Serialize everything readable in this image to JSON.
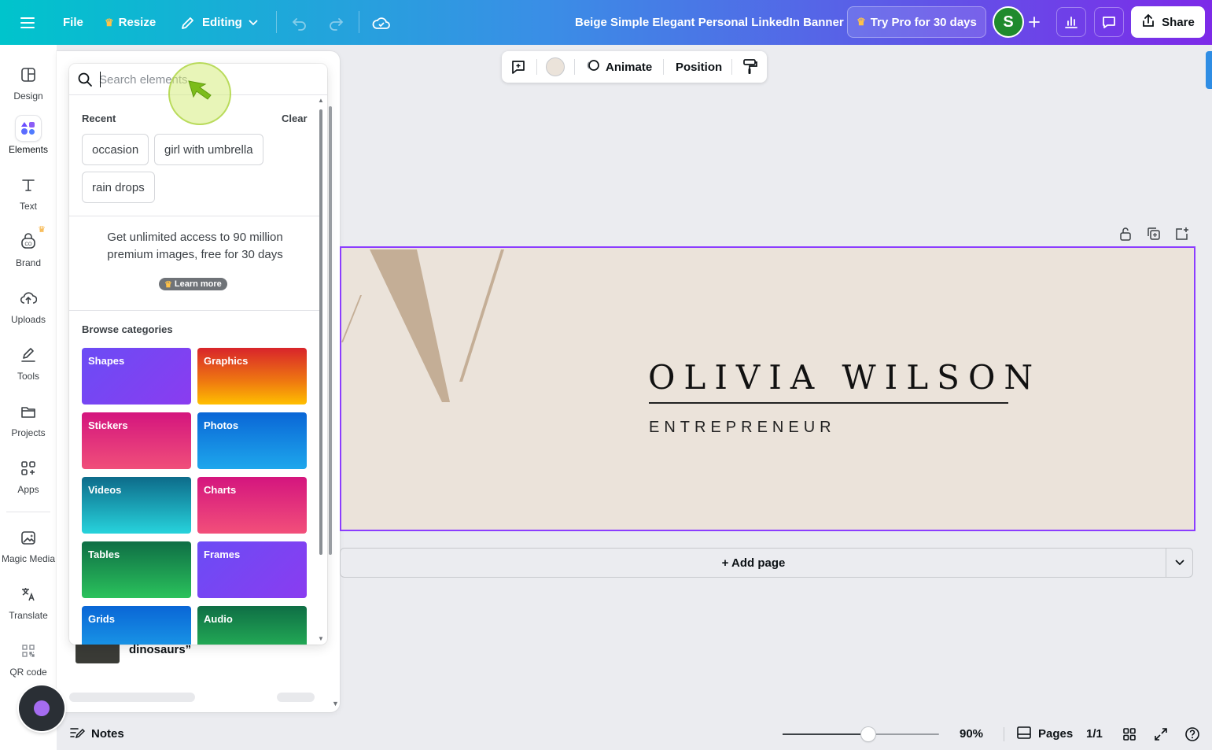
{
  "topbar": {
    "file_label": "File",
    "resize_label": "Resize",
    "editing_label": "Editing",
    "design_title": "Beige Simple Elegant Personal LinkedIn Banner",
    "try_pro_label": "Try Pro for 30 days",
    "avatar_letter": "S",
    "share_label": "Share"
  },
  "sidebar": {
    "items": [
      {
        "label": "Design",
        "icon": "layout-icon"
      },
      {
        "label": "Elements",
        "icon": "elements-icon"
      },
      {
        "label": "Text",
        "icon": "text-icon"
      },
      {
        "label": "Brand",
        "icon": "brand-icon"
      },
      {
        "label": "Uploads",
        "icon": "cloud-upload-icon"
      },
      {
        "label": "Tools",
        "icon": "pen-icon"
      },
      {
        "label": "Projects",
        "icon": "folder-icon"
      },
      {
        "label": "Apps",
        "icon": "apps-icon"
      },
      {
        "label": "Magic Media",
        "icon": "magic-media-icon"
      },
      {
        "label": "Translate",
        "icon": "translate-icon"
      },
      {
        "label": "QR code",
        "icon": "qr-code-icon"
      }
    ]
  },
  "panel": {
    "search_placeholder": "Search elements",
    "recent_label": "Recent",
    "clear_label": "Clear",
    "recent_chips": [
      "occasion",
      "girl with umbrella",
      "rain drops"
    ],
    "promo_line1": "Get unlimited access to 90 million",
    "promo_line2": "premium images, free for 30 days",
    "learn_more_label": "Learn more",
    "browse_label": "Browse categories",
    "categories": [
      "Shapes",
      "Graphics",
      "Stickers",
      "Photos",
      "Videos",
      "Charts",
      "Tables",
      "Frames",
      "Grids",
      "Audio"
    ],
    "peek_text": "dinosaurs”"
  },
  "toolbar": {
    "animate_label": "Animate",
    "position_label": "Position",
    "swatch_color": "#ebe3da"
  },
  "canvas": {
    "name": "OLIVIA WILSON",
    "role": "ENTREPRENEUR",
    "bg_color": "#ebe3da",
    "accent_color": "#c4ae96",
    "selection_color": "#8b3dff",
    "add_page_label": "+ Add page"
  },
  "bottombar": {
    "notes_label": "Notes",
    "zoom_value": "90%",
    "zoom_level": 0.55,
    "pages_label": "Pages",
    "page_count": "1/1"
  }
}
